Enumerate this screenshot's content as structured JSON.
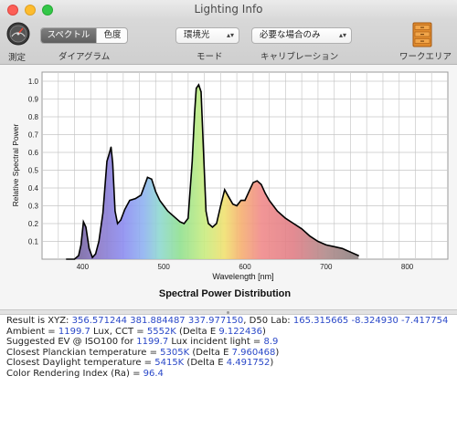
{
  "window": {
    "title": "Lighting Info"
  },
  "toolbar": {
    "measure_label": "測定",
    "view_tabs": {
      "spectrum": "スペクトル",
      "color": "色度",
      "group_label": "ダイアグラム"
    },
    "mode": {
      "value": "環境光",
      "label": "モード"
    },
    "calibration": {
      "value": "必要な場合のみ",
      "label": "キャリブレーション"
    },
    "workarea_label": "ワークエリア"
  },
  "chart_data": {
    "type": "line",
    "title": "Spectral Power Distribution",
    "xlabel": "Wavelength [nm]",
    "ylabel": "Relative Spectral Power",
    "xlim": [
      350,
      850
    ],
    "ylim": [
      0,
      1.0
    ],
    "xticks": [
      "400",
      "500",
      "600",
      "700",
      "800"
    ],
    "yticks": [
      "0.1",
      "0.2",
      "0.3",
      "0.4",
      "0.5",
      "0.6",
      "0.7",
      "0.8",
      "0.9",
      "1.0"
    ],
    "fill": "visible-spectrum",
    "x": [
      380,
      390,
      395,
      398,
      401,
      404,
      408,
      412,
      416,
      420,
      425,
      430,
      432,
      435,
      437,
      440,
      443,
      447,
      452,
      458,
      465,
      472,
      480,
      485,
      490,
      495,
      500,
      505,
      510,
      515,
      520,
      525,
      530,
      535,
      538,
      540,
      543,
      546,
      549,
      552,
      555,
      560,
      565,
      570,
      575,
      580,
      585,
      590,
      595,
      600,
      605,
      610,
      615,
      620,
      625,
      630,
      640,
      650,
      660,
      670,
      680,
      690,
      700,
      710,
      720,
      730,
      740
    ],
    "values": [
      0.0,
      0.0,
      0.02,
      0.08,
      0.21,
      0.18,
      0.06,
      0.01,
      0.03,
      0.1,
      0.26,
      0.55,
      0.58,
      0.63,
      0.54,
      0.27,
      0.2,
      0.22,
      0.28,
      0.33,
      0.34,
      0.36,
      0.46,
      0.45,
      0.38,
      0.33,
      0.3,
      0.27,
      0.25,
      0.23,
      0.21,
      0.2,
      0.23,
      0.55,
      0.82,
      0.96,
      0.98,
      0.94,
      0.6,
      0.27,
      0.2,
      0.18,
      0.2,
      0.3,
      0.39,
      0.35,
      0.31,
      0.3,
      0.33,
      0.33,
      0.38,
      0.43,
      0.44,
      0.42,
      0.37,
      0.33,
      0.27,
      0.23,
      0.2,
      0.17,
      0.13,
      0.1,
      0.08,
      0.07,
      0.06,
      0.04,
      0.02
    ]
  },
  "results": {
    "xyz": {
      "prefix": "Result is XYZ: ",
      "values": "356.571244 381.884487 337.977150",
      "mid": ", D50 Lab: ",
      "lab": "165.315665 -8.324930 -7.417754"
    },
    "ambient": {
      "prefix": "Ambient = ",
      "lux": "1199.7",
      "mid": " Lux, CCT = ",
      "cct": "5552K",
      "mid2": " (Delta E ",
      "delta": "9.122436",
      "suffix": ")"
    },
    "ev": {
      "prefix": "Suggested EV @ ISO100 for ",
      "lux": "1199.7",
      "mid": " Lux incident light = ",
      "ev": "8.9"
    },
    "planckian": {
      "prefix": "Closest Planckian temperature = ",
      "temp": "5305K",
      "mid": " (Delta E ",
      "delta": "7.960468",
      "suffix": ")"
    },
    "daylight": {
      "prefix": "Closest Daylight temperature  = ",
      "temp": "5415K",
      "mid": " (Delta E ",
      "delta": "4.491752",
      "suffix": ")"
    },
    "cri": {
      "prefix": "Color Rendering Index (Ra) = ",
      "value": "96.4"
    }
  }
}
